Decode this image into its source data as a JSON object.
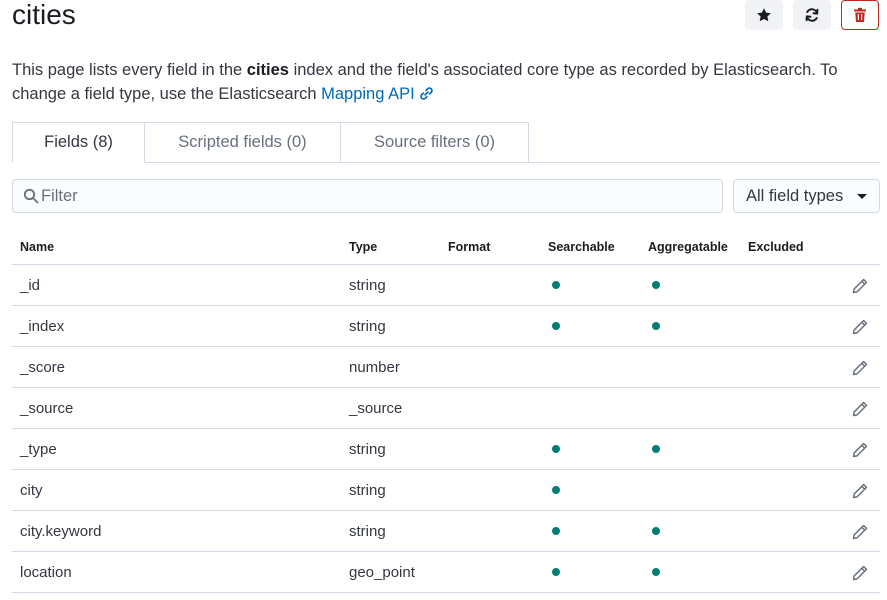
{
  "header": {
    "title": "cities",
    "buttons": {
      "favorite_icon": "star-icon",
      "refresh_icon": "refresh-icon",
      "delete_icon": "trash-icon"
    }
  },
  "description": {
    "prefix": "This page lists every field in the ",
    "index_name": "cities",
    "middle": " index and the field's associated core type as recorded by Elasticsearch. To change a field type, use the Elasticsearch ",
    "link_text": "Mapping API"
  },
  "tabs": [
    {
      "label": "Fields (8)",
      "selected": true
    },
    {
      "label": "Scripted fields (0)",
      "selected": false
    },
    {
      "label": "Source filters (0)",
      "selected": false
    }
  ],
  "filter": {
    "placeholder": "Filter",
    "value": ""
  },
  "type_select": {
    "value": "All field types"
  },
  "table": {
    "headers": {
      "name": "Name",
      "type": "Type",
      "format": "Format",
      "searchable": "Searchable",
      "aggregatable": "Aggregatable",
      "excluded": "Excluded"
    },
    "rows": [
      {
        "name": "_id",
        "type": "string",
        "searchable": true,
        "aggregatable": true
      },
      {
        "name": "_index",
        "type": "string",
        "searchable": true,
        "aggregatable": true
      },
      {
        "name": "_score",
        "type": "number",
        "searchable": false,
        "aggregatable": false
      },
      {
        "name": "_source",
        "type": "_source",
        "searchable": false,
        "aggregatable": false
      },
      {
        "name": "_type",
        "type": "string",
        "searchable": true,
        "aggregatable": true
      },
      {
        "name": "city",
        "type": "string",
        "searchable": true,
        "aggregatable": false
      },
      {
        "name": "city.keyword",
        "type": "string",
        "searchable": true,
        "aggregatable": true
      },
      {
        "name": "location",
        "type": "geo_point",
        "searchable": true,
        "aggregatable": true
      }
    ]
  },
  "colors": {
    "accent": "#006bb4",
    "indicator": "#017d73",
    "danger": "#bd271e",
    "border": "#d3dae6"
  }
}
